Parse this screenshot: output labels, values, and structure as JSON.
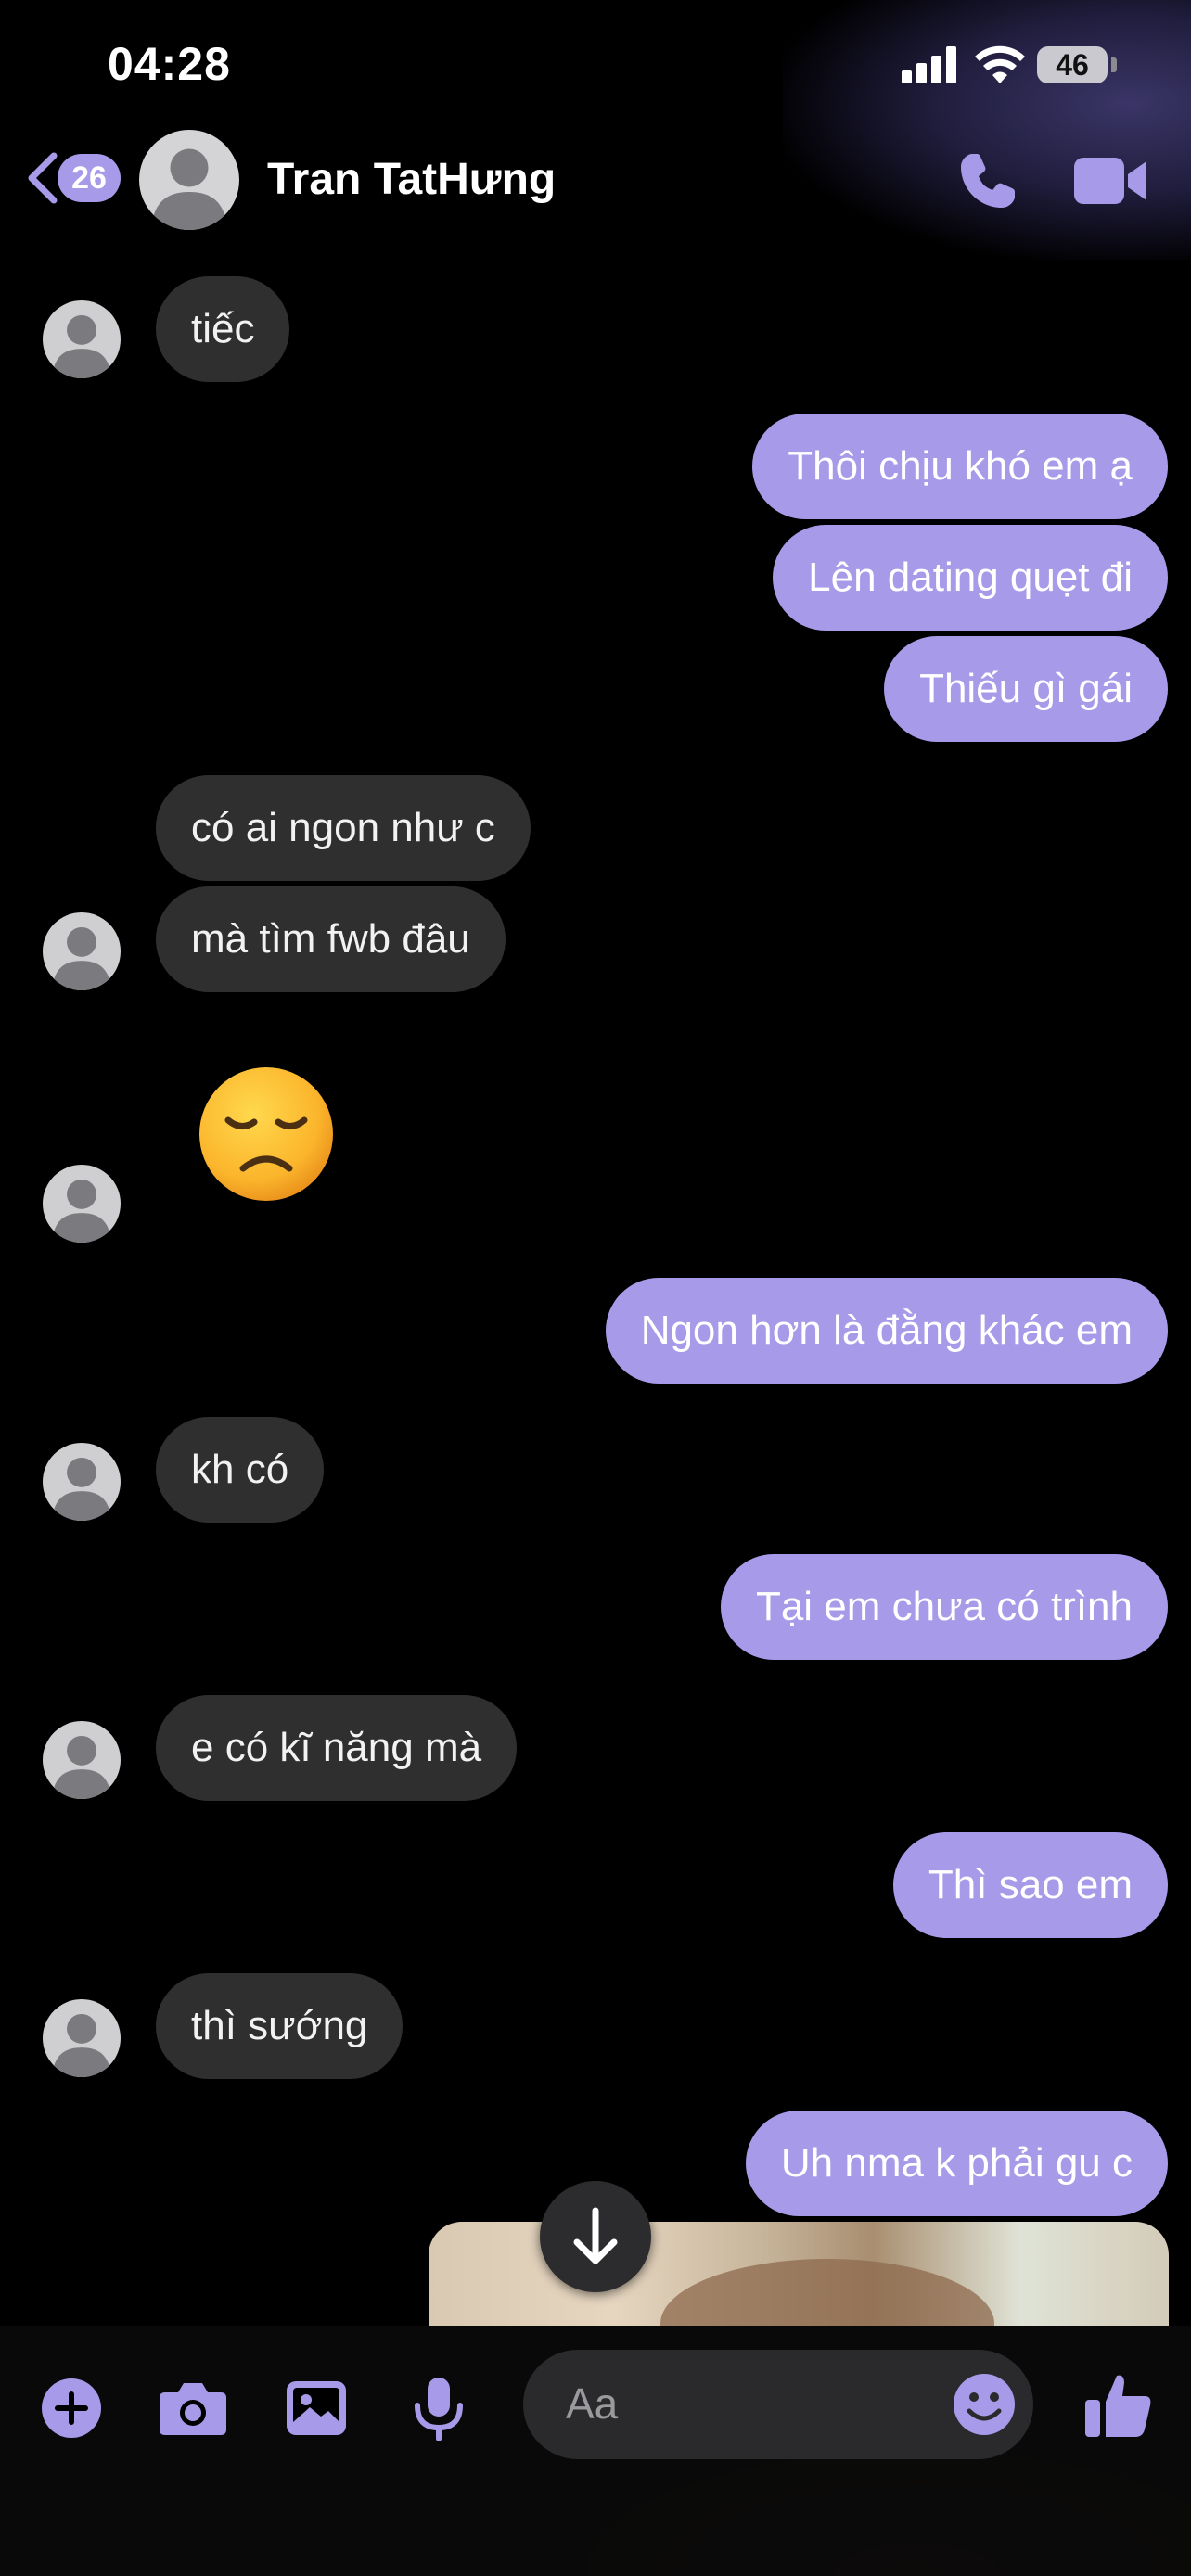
{
  "status_bar": {
    "time": "04:28",
    "battery": "46"
  },
  "header": {
    "back_count": "26",
    "contact_name": "Tran TatHưng"
  },
  "messages": [
    {
      "dir": "in",
      "text": "tiếc"
    },
    {
      "dir": "out",
      "text": "Thôi chịu khó em ạ"
    },
    {
      "dir": "out",
      "text": "Lên dating quẹt đi"
    },
    {
      "dir": "out",
      "text": "Thiếu gì gái"
    },
    {
      "dir": "in",
      "text": "có ai ngon như c"
    },
    {
      "dir": "in",
      "text": "mà tìm fwb đâu"
    },
    {
      "dir": "in",
      "text": "😞",
      "emoji_name": "disappointed-face"
    },
    {
      "dir": "out",
      "text": "Ngon hơn là đằng khác em"
    },
    {
      "dir": "in",
      "text": "kh có"
    },
    {
      "dir": "out",
      "text": "Tại em chưa có trình"
    },
    {
      "dir": "in",
      "text": "e có kĩ năng mà"
    },
    {
      "dir": "out",
      "text": "Thì sao em"
    },
    {
      "dir": "in",
      "text": "thì sướng"
    },
    {
      "dir": "out",
      "text": "Uh nma k phải gu c"
    }
  ],
  "composer": {
    "placeholder": "Aa",
    "icons": [
      "plus-icon",
      "camera-icon",
      "gallery-icon",
      "microphone-icon",
      "emoji-icon",
      "thumbs-up-icon"
    ]
  },
  "colors": {
    "accent": "#a79ae8",
    "incoming_bubble": "#2f2f30",
    "background": "#000000"
  }
}
